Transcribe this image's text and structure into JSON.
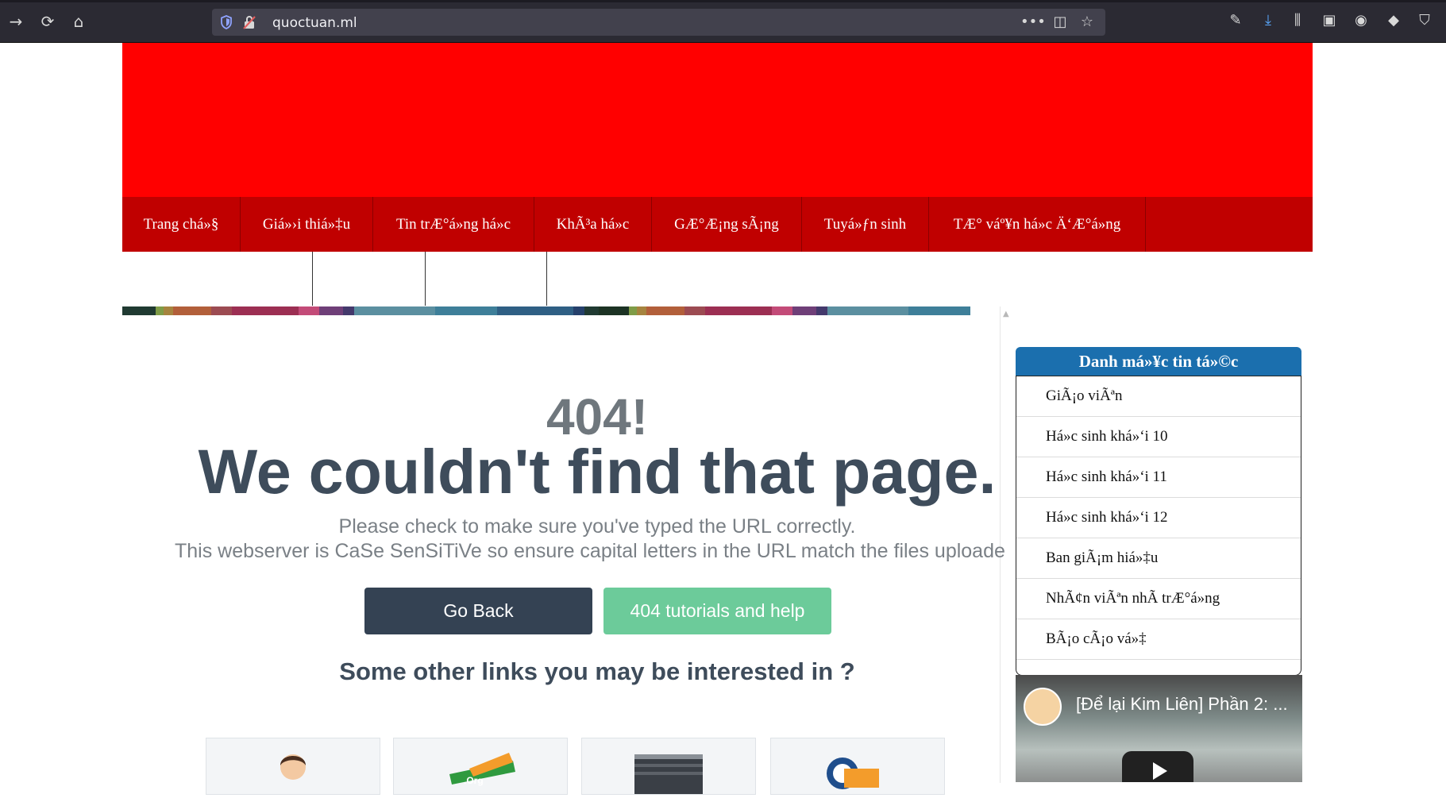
{
  "browser": {
    "url": "quoctuan.ml"
  },
  "nav": {
    "items": [
      "Trang chá»§",
      "Giá»›i thiá»‡u",
      "Tin trÆ°á»ng há»c",
      "KhÃ³a há»c",
      "GÆ°Æ¡ng sÃ¡ng",
      "Tuyá»ƒn sinh",
      "TÆ° váº¥n há»c Ä‘Æ°á»ng"
    ]
  },
  "error_page": {
    "code": "404!",
    "headline": "We couldn't find that page.",
    "message_1": "Please check to make sure you've typed the URL correctly.",
    "message_2": "This webserver is CaSe SenSiTiVe so ensure capital letters in the URL match the files uploade",
    "back_button": "Go Back",
    "help_button": "404 tutorials and help",
    "links_title": "Some other links you may be interested in ?"
  },
  "sidebar": {
    "title": "Danh má»¥c tin tá»©c",
    "items": [
      "GiÃ¡o viÃªn",
      "Há»c sinh khá»‘i 10",
      "Há»c sinh khá»‘i 11",
      "Há»c sinh khá»‘i 12",
      "Ban giÃ¡m hiá»‡u",
      "NhÃ¢n viÃªn nhÃ  trÆ°á»ng",
      "BÃ¡o cÃ¡o vá»‡"
    ],
    "video_title": "[Để lại Kim Liên] Phần 2: ..."
  },
  "colors": {
    "banner": "#ff0000",
    "navbar": "#c00000",
    "sidebar_header": "#1b6fae",
    "back_button": "#344253",
    "help_button": "#6ccb9a"
  }
}
